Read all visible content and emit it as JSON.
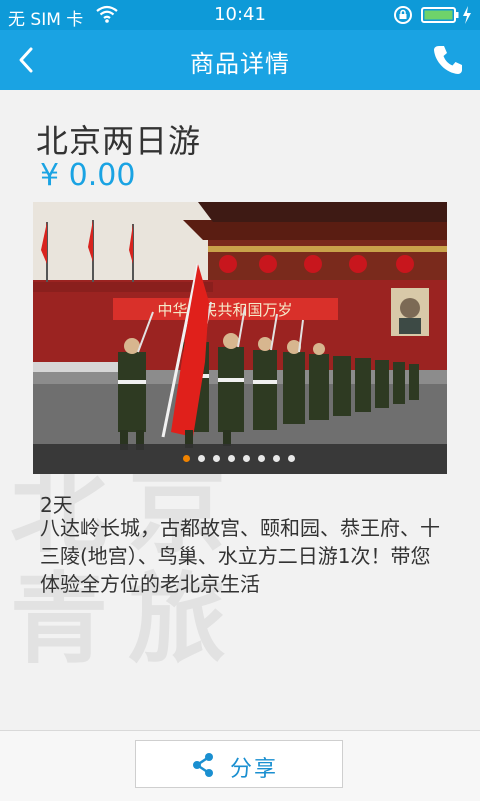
{
  "status_bar": {
    "carrier": "无 SIM 卡",
    "time": "10:41",
    "icons": [
      "wifi-icon",
      "rotation-lock-icon",
      "battery-icon",
      "charging-icon"
    ]
  },
  "nav": {
    "title": "商品详情",
    "back_icon": "chevron-left-icon",
    "phone_icon": "phone-icon"
  },
  "product": {
    "title": "北京两日游",
    "price": "¥ 0.00",
    "duration": "2天",
    "description": "八达岭长城，古都故宫、颐和园、恭王府、十三陵(地宫）、鸟巢、水立方二日游1次！带您体验全方位的老北京生活"
  },
  "carousel": {
    "image_alt": "Honor guard flag ceremony at Tiananmen",
    "banner_text": "中华人民共和国万岁",
    "slide_count": 8,
    "active_index": 0
  },
  "watermark": {
    "text": "北京\n青旅"
  },
  "bottom_bar": {
    "share_label": "分享",
    "share_icon": "share-icon"
  },
  "colors": {
    "status_bar": "#0e9ad8",
    "nav_bar": "#1aa3e3",
    "price": "#1aa3e3",
    "active_dot": "#f08300"
  }
}
